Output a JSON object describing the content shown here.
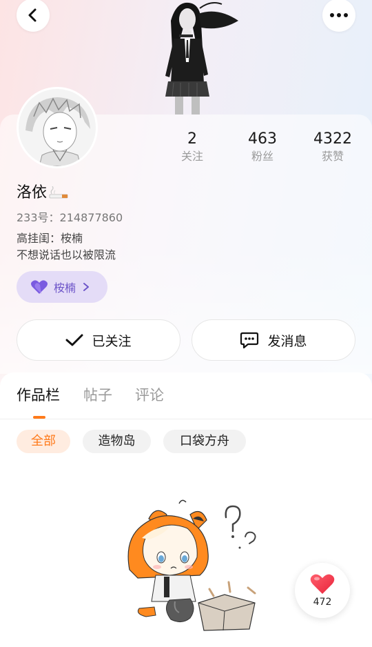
{
  "header": {
    "back_icon": "chevron-left-icon",
    "more_icon": "more-dots-icon"
  },
  "profile": {
    "username": "洛依",
    "name_decoration_icon": "cigarette-icon",
    "uid_text": "233号：214877860",
    "bio_line1": "高挂闺：桉楠",
    "bio_line2": "不想说话也以被限流"
  },
  "stats": [
    {
      "value": "2",
      "label": "关注"
    },
    {
      "value": "463",
      "label": "粉丝"
    },
    {
      "value": "4322",
      "label": "获赞"
    }
  ],
  "fan_badge": {
    "label": "桉楠",
    "icon": "purple-heart-icon",
    "color": "#6d55c9"
  },
  "actions": {
    "follow_label": "已关注",
    "message_label": "发消息"
  },
  "tabs": [
    {
      "label": "作品栏",
      "active": true
    },
    {
      "label": "帖子",
      "active": false
    },
    {
      "label": "评论",
      "active": false
    }
  ],
  "filters": [
    {
      "label": "全部",
      "active": true
    },
    {
      "label": "造物岛",
      "active": false
    },
    {
      "label": "口袋方舟",
      "active": false
    }
  ],
  "like_fab": {
    "count": "472",
    "icon": "heart-icon"
  },
  "colors": {
    "accent": "#ff7a1a",
    "badge_bg": "#e4dcf7",
    "heart": "#f23c4c"
  }
}
